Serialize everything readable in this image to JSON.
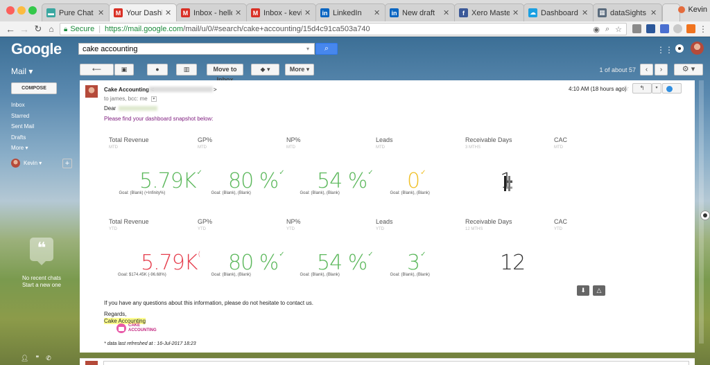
{
  "browser": {
    "tabs": [
      {
        "label": "Pure Chat - Da",
        "icon": "chat-icon",
        "color": "#3aa7a0",
        "active": false
      },
      {
        "label": "Your Dashboar",
        "icon": "gmail-icon",
        "color": "#d93025",
        "active": true
      },
      {
        "label": "Inbox - hello@",
        "icon": "gmail-icon",
        "color": "#d93025",
        "active": false
      },
      {
        "label": "Inbox - kevinw",
        "icon": "gmail-icon",
        "color": "#d93025",
        "active": false
      },
      {
        "label": "LinkedIn",
        "icon": "linkedin-icon",
        "color": "#0a66c2",
        "active": false
      },
      {
        "label": "New draft",
        "icon": "linkedin-icon",
        "color": "#0a66c2",
        "active": false
      },
      {
        "label": "Xero Mastermi",
        "icon": "facebook-icon",
        "color": "#3b5998",
        "active": false
      },
      {
        "label": "Dashboard - M",
        "icon": "cloud-icon",
        "color": "#1ba0e2",
        "active": false
      },
      {
        "label": "dataSights | Xe",
        "icon": "grid-icon",
        "color": "#5a6b7d",
        "active": false
      }
    ],
    "profile_name": "Kevin",
    "secure_label": "Secure",
    "url_host": "https://mail.google.com",
    "url_path": "/mail/u/0/#search/cake+accounting/15d4c91ca503a740"
  },
  "gmail": {
    "logo": "Google",
    "search_value": "cake accounting",
    "mail_label": "Mail",
    "toolbar": {
      "move_to_inbox": "Move to Inbox",
      "more": "More",
      "page_count": "1 of about 57"
    },
    "compose": "COMPOSE",
    "nav": [
      "Inbox",
      "Starred",
      "Sent Mail",
      "Drafts",
      "More"
    ],
    "hangout_user": "Kevin",
    "no_chats": "No recent chats",
    "start_chat": "Start a new one"
  },
  "email": {
    "sender": "Cake Accounting <",
    "sender_close": ">",
    "to": "to james, bcc: me",
    "time": "4:10 AM (18 hours ago)",
    "dear": "Dear",
    "intro": "Please find your dashboard snapshot below:",
    "outro": "If you have any questions about this information, please do not hesitate to contact us.",
    "regards": "Regards,",
    "signature": "Cake Accounting",
    "logo_line1": "CAKE",
    "logo_line2": "ACCOUNTING",
    "refreshed": "* data last refreshed at : 16-Jul-2017 18:23"
  },
  "colors": {
    "good": "#5cb85c",
    "bad": "#e53e4d",
    "warn": "#f0c028",
    "neutral": "#333333"
  },
  "kpis_mtd": [
    {
      "label": "Total Revenue",
      "period": "MTD",
      "value": "5.79K",
      "goal": "Goal: (Blank) (+Infinity%)",
      "status": "good"
    },
    {
      "label": "GP%",
      "period": "MTD",
      "value": "80 %",
      "goal": "Goal: (Blank), (Blank)",
      "status": "good"
    },
    {
      "label": "NP%",
      "period": "MTD",
      "value": "54 %",
      "goal": "Goal: (Blank), (Blank)",
      "status": "good"
    },
    {
      "label": "Leads",
      "period": "MTD",
      "value": "0",
      "goal": "Goal: (Blank), (Blank)",
      "status": "warn"
    },
    {
      "label": "Receivable Days",
      "period": "3 MTHS",
      "value": "1",
      "goal": "",
      "status": "neutral"
    },
    {
      "label": "CAC",
      "period": "MTD",
      "value": "",
      "goal": "",
      "status": "neutral"
    }
  ],
  "kpis_ytd": [
    {
      "label": "Total Revenue",
      "period": "YTD",
      "value": "5.79K",
      "goal": "Goal: $174.45K (-96.68%)",
      "status": "bad"
    },
    {
      "label": "GP%",
      "period": "YTD",
      "value": "80 %",
      "goal": "Goal: (Blank), (Blank)",
      "status": "good"
    },
    {
      "label": "NP%",
      "period": "YTD",
      "value": "54 %",
      "goal": "Goal: (Blank), (Blank)",
      "status": "good"
    },
    {
      "label": "Leads",
      "period": "YTD",
      "value": "3",
      "goal": "Goal: (Blank), (Blank)",
      "status": "good"
    },
    {
      "label": "Receivable Days",
      "period": "12 MTHS",
      "value": "12",
      "goal": "",
      "status": "neutral"
    },
    {
      "label": "CAC",
      "period": "YTD",
      "value": "",
      "goal": "",
      "status": "neutral"
    }
  ]
}
